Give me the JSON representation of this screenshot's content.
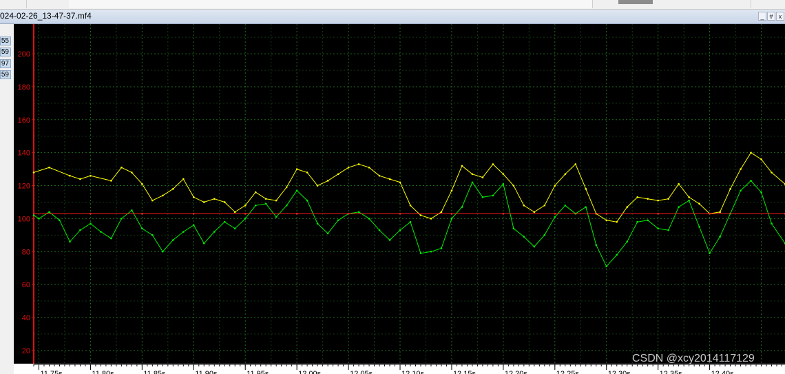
{
  "window": {
    "title": "024-02-26_13-47-37.mf4",
    "buttons": [
      "_",
      "#",
      "x"
    ]
  },
  "left_values": [
    "55",
    "59",
    "97",
    "59"
  ],
  "watermark": "CSDN @xcy2014117129",
  "chart_data": {
    "type": "line",
    "xlabel": "",
    "ylabel": "",
    "ylim": [
      12,
      218
    ],
    "xlim": [
      11.745,
      12.473
    ],
    "grid": true,
    "y_ticks": [
      20,
      40,
      60,
      80,
      100,
      120,
      140,
      160,
      180,
      200
    ],
    "x_ticks": [
      "11.75s",
      "11.80s",
      "11.85s",
      "11.90s",
      "11.95s",
      "12.00s",
      "12.05s",
      "12.10s",
      "12.15s",
      "12.20s",
      "12.25s",
      "12.30s",
      "12.35s",
      "12.40s"
    ],
    "x_tick_values": [
      11.75,
      11.8,
      11.85,
      11.9,
      11.95,
      12.0,
      12.05,
      12.1,
      12.15,
      12.2,
      12.25,
      12.3,
      12.35,
      12.4
    ],
    "series": [
      {
        "color": "#ffff00",
        "x": [
          11.745,
          11.76,
          11.78,
          11.79,
          11.8,
          11.82,
          11.83,
          11.84,
          11.85,
          11.86,
          11.87,
          11.88,
          11.89,
          11.9,
          11.91,
          11.92,
          11.93,
          11.94,
          11.95,
          11.96,
          11.97,
          11.98,
          11.99,
          12.0,
          12.01,
          12.02,
          12.03,
          12.04,
          12.05,
          12.06,
          12.07,
          12.08,
          12.09,
          12.1,
          12.11,
          12.12,
          12.13,
          12.14,
          12.15,
          12.16,
          12.17,
          12.18,
          12.19,
          12.2,
          12.21,
          12.22,
          12.23,
          12.24,
          12.25,
          12.26,
          12.27,
          12.28,
          12.29,
          12.3,
          12.31,
          12.32,
          12.33,
          12.34,
          12.35,
          12.36,
          12.37,
          12.38,
          12.39,
          12.4,
          12.41,
          12.42,
          12.43,
          12.44,
          12.45,
          12.46,
          12.473
        ],
        "y": [
          128,
          131,
          126,
          124,
          126,
          123,
          131,
          128,
          121,
          111,
          114,
          118,
          124,
          113,
          110,
          112,
          110,
          104,
          108,
          116,
          112,
          111,
          119,
          130,
          128,
          120,
          123,
          127,
          131,
          133,
          131,
          126,
          124,
          122,
          108,
          102,
          100,
          104,
          117,
          132,
          127,
          125,
          133,
          127,
          120,
          108,
          104,
          108,
          120,
          127,
          133,
          118,
          103,
          99,
          98,
          107,
          113,
          112,
          111,
          112,
          121,
          113,
          109,
          103,
          104,
          118,
          130,
          140,
          136,
          128,
          121
        ]
      },
      {
        "color": "#00ee00",
        "x": [
          11.745,
          11.75,
          11.76,
          11.77,
          11.78,
          11.79,
          11.8,
          11.81,
          11.82,
          11.83,
          11.84,
          11.85,
          11.86,
          11.87,
          11.88,
          11.89,
          11.9,
          11.91,
          11.92,
          11.93,
          11.94,
          11.95,
          11.96,
          11.97,
          11.98,
          11.99,
          12.0,
          12.01,
          12.02,
          12.03,
          12.04,
          12.05,
          12.06,
          12.07,
          12.08,
          12.09,
          12.1,
          12.11,
          12.12,
          12.13,
          12.14,
          12.15,
          12.16,
          12.17,
          12.18,
          12.19,
          12.2,
          12.21,
          12.22,
          12.23,
          12.24,
          12.25,
          12.26,
          12.27,
          12.28,
          12.29,
          12.3,
          12.31,
          12.32,
          12.33,
          12.34,
          12.35,
          12.36,
          12.37,
          12.38,
          12.39,
          12.4,
          12.41,
          12.42,
          12.43,
          12.44,
          12.45,
          12.46,
          12.473
        ],
        "y": [
          102,
          100,
          104,
          99,
          86,
          93,
          97,
          92,
          88,
          100,
          105,
          94,
          90,
          80,
          87,
          92,
          96,
          85,
          92,
          98,
          94,
          100,
          108,
          109,
          101,
          108,
          117,
          111,
          97,
          91,
          99,
          103,
          104,
          100,
          93,
          87,
          93,
          98,
          79,
          80,
          82,
          100,
          107,
          122,
          113,
          114,
          121,
          94,
          89,
          83,
          90,
          101,
          108,
          103,
          107,
          84,
          71,
          78,
          86,
          98,
          99,
          94,
          93,
          107,
          111,
          95,
          79,
          89,
          103,
          117,
          123,
          116,
          97,
          85
        ]
      },
      {
        "color": "#ff2020",
        "x": [
          11.745,
          11.8,
          11.85,
          11.9,
          11.95,
          12.0,
          12.05,
          12.1,
          12.15,
          12.2,
          12.25,
          12.3,
          12.35,
          12.4,
          12.473
        ],
        "y": [
          103,
          103,
          103,
          103,
          103,
          103,
          103,
          103,
          103,
          103,
          103,
          103,
          103,
          103,
          103
        ]
      }
    ]
  }
}
